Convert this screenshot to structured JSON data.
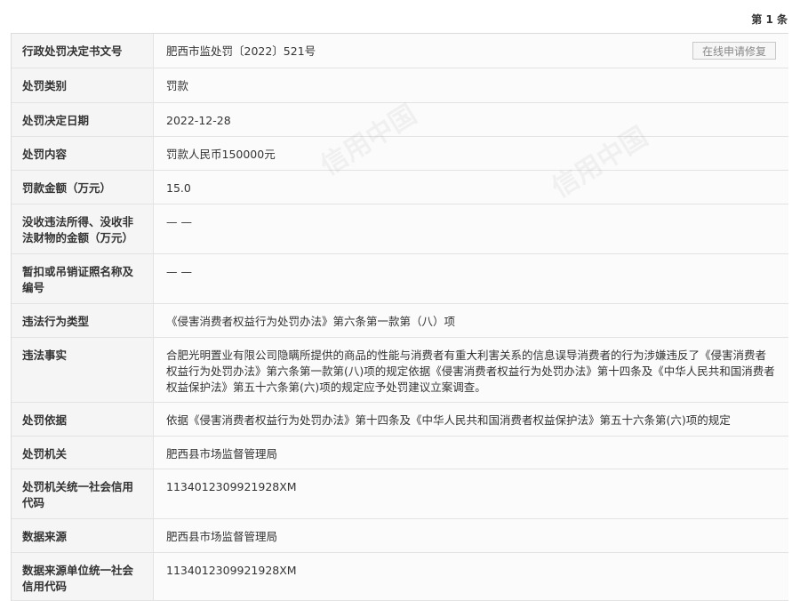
{
  "page_indicator": "第 1 条",
  "repair_button": "在线申请修复",
  "watermark": "信用中国",
  "rows": [
    {
      "label": "行政处罚决定书文号",
      "value": "肥西市监处罚〔2022〕521号"
    },
    {
      "label": "处罚类别",
      "value": "罚款"
    },
    {
      "label": "处罚决定日期",
      "value": "2022-12-28"
    },
    {
      "label": "处罚内容",
      "value": "罚款人民币150000元"
    },
    {
      "label": "罚款金额（万元）",
      "value": "15.0"
    },
    {
      "label": "没收违法所得、没收非法财物的金额（万元）",
      "value": "— —"
    },
    {
      "label": "暂扣或吊销证照名称及编号",
      "value": "— —"
    },
    {
      "label": "违法行为类型",
      "value": "《侵害消费者权益行为处罚办法》第六条第一款第（八）项"
    },
    {
      "label": "违法事实",
      "value": "合肥光明置业有限公司隐瞒所提供的商品的性能与消费者有重大利害关系的信息误导消费者的行为涉嫌违反了《侵害消费者权益行为处罚办法》第六条第一款第(八)项的规定依据《侵害消费者权益行为处罚办法》第十四条及《中华人民共和国消费者权益保护法》第五十六条第(六)项的规定应予处罚建议立案调查。"
    },
    {
      "label": "处罚依据",
      "value": "依据《侵害消费者权益行为处罚办法》第十四条及《中华人民共和国消费者权益保护法》第五十六条第(六)项的规定"
    },
    {
      "label": "处罚机关",
      "value": "肥西县市场监督管理局"
    },
    {
      "label": "处罚机关统一社会信用代码",
      "value": "1134012309921928XM"
    },
    {
      "label": "数据来源",
      "value": "肥西县市场监督管理局"
    },
    {
      "label": "数据来源单位统一社会信用代码",
      "value": "1134012309921928XM"
    }
  ]
}
